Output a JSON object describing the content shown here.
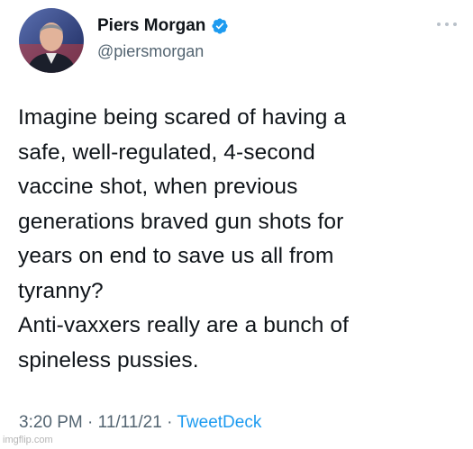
{
  "author": {
    "display_name": "Piers Morgan",
    "handle": "@piersmorgan",
    "verified": true,
    "avatar_icon": "profile-photo"
  },
  "tweet": {
    "lines": [
      "Imagine being scared of having a",
      "safe, well-regulated, 4-second",
      "vaccine shot, when previous",
      "generations braved gun shots for",
      "years on end to save us all from",
      "tyranny?",
      "Anti-vaxxers really are a bunch of",
      "spineless pussies."
    ]
  },
  "meta": {
    "time": "3:20 PM",
    "separator": "·",
    "date": "11/11/21",
    "source": "TweetDeck"
  },
  "watermark": "imgflip.com",
  "colors": {
    "text": "#0f1419",
    "secondary": "#536471",
    "accent": "#1d9bf0"
  }
}
